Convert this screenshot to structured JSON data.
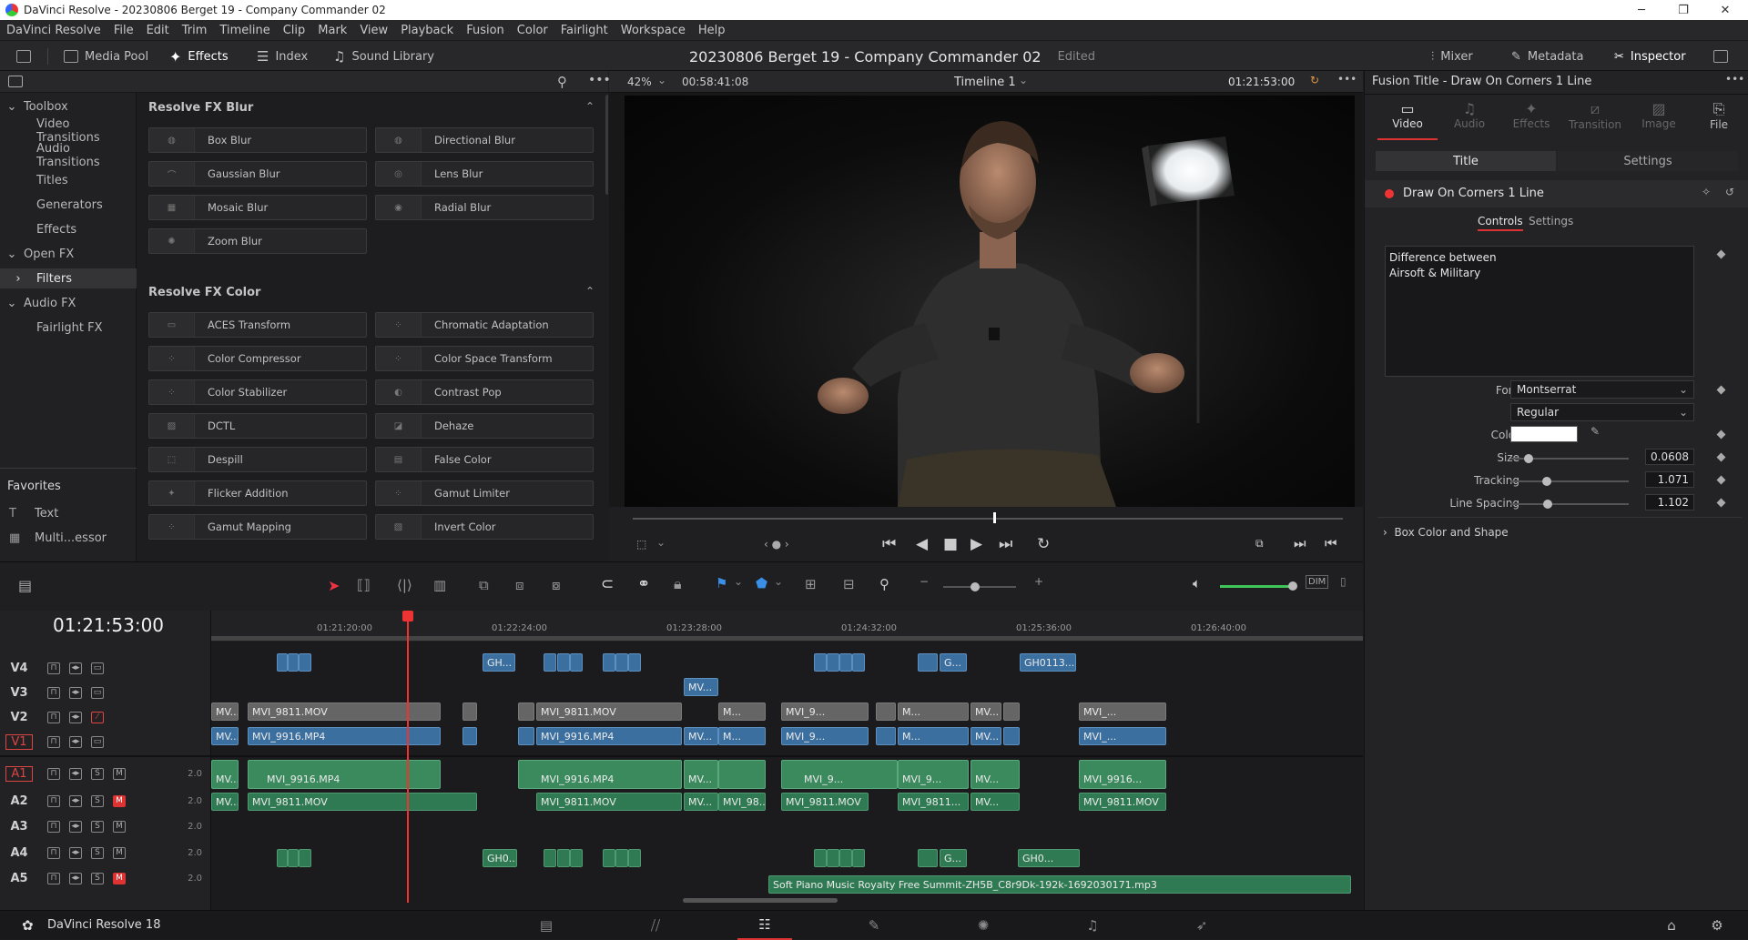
{
  "window": {
    "title": "DaVinci Resolve - 20230806 Berget 19 - Company Commander 02"
  },
  "menu": [
    "DaVinci Resolve",
    "File",
    "Edit",
    "Trim",
    "Timeline",
    "Clip",
    "Mark",
    "View",
    "Playback",
    "Fusion",
    "Color",
    "Fairlight",
    "Workspace",
    "Help"
  ],
  "toolbar": {
    "media_pool": "Media Pool",
    "effects": "Effects",
    "index": "Index",
    "sound_library": "Sound Library",
    "project_title": "20230806 Berget 19 - Company Commander 02",
    "edited": "Edited",
    "mixer": "Mixer",
    "metadata": "Metadata",
    "inspector": "Inspector"
  },
  "toolbox": {
    "items": [
      "Toolbox",
      "Video Transitions",
      "Audio Transitions",
      "Titles",
      "Generators",
      "Effects",
      "Open FX",
      "Filters",
      "Audio FX",
      "Fairlight FX"
    ],
    "favorites_label": "Favorites",
    "favorites": [
      "Text",
      "Multi...essor"
    ]
  },
  "fx": {
    "blur_header": "Resolve FX Blur",
    "blur": [
      "Box Blur",
      "Directional Blur",
      "Gaussian Blur",
      "Lens Blur",
      "Mosaic Blur",
      "Radial Blur",
      "Zoom Blur"
    ],
    "color_header": "Resolve FX Color",
    "color": [
      "ACES Transform",
      "Chromatic Adaptation",
      "Color Compressor",
      "Color Space Transform",
      "Color Stabilizer",
      "Contrast Pop",
      "DCTL",
      "Dehaze",
      "Despill",
      "False Color",
      "Flicker Addition",
      "Gamut Limiter",
      "Gamut Mapping",
      "Invert Color"
    ]
  },
  "viewer": {
    "zoom": "42%",
    "source_tc": "00:58:41:08",
    "timeline_name": "Timeline 1",
    "record_tc": "01:21:53:00"
  },
  "inspector": {
    "header": "Fusion Title - Draw On Corners 1 Line",
    "tabs": [
      "Video",
      "Audio",
      "Effects",
      "Transition",
      "Image",
      "File"
    ],
    "subtabs": [
      "Title",
      "Settings"
    ],
    "effect_name": "Draw On Corners 1 Line",
    "ctrl_tabs": [
      "Controls",
      "Settings"
    ],
    "text_line1": "Difference between",
    "text_line2": "Airsoft & Military",
    "font_label": "Font",
    "font": "Montserrat",
    "style": "Regular",
    "color_label": "Color",
    "color_value": "#ffffff",
    "size_label": "Size",
    "size": "0.0608",
    "tracking_label": "Tracking",
    "tracking": "1.071",
    "line_spacing_label": "Line Spacing",
    "line_spacing": "1.102",
    "box_section": "Box Color and Shape"
  },
  "timeline": {
    "timecode": "01:21:53:00",
    "ruler": [
      "01:21:20:00",
      "01:22:24:00",
      "01:23:28:00",
      "01:24:32:00",
      "01:25:36:00",
      "01:26:40:00"
    ],
    "tracks": [
      {
        "name": "V4"
      },
      {
        "name": "V3"
      },
      {
        "name": "V2"
      },
      {
        "name": "V1"
      },
      {
        "name": "A1",
        "level": "2.0"
      },
      {
        "name": "A2",
        "level": "2.0"
      },
      {
        "name": "A3",
        "level": "2.0"
      },
      {
        "name": "A4",
        "level": "2.0"
      },
      {
        "name": "A5",
        "level": "2.0"
      }
    ],
    "clips": {
      "v4": [
        "GH...",
        "G...",
        "GH0113..."
      ],
      "v3": [
        "MV..."
      ],
      "v2": [
        "MV...",
        "MVI_9811.MOV",
        "MVI_9811.MOV",
        "M...",
        "MVI_9...",
        "M...",
        "MV...",
        "MVI_..."
      ],
      "v1": [
        "MV...",
        "MVI_9916.MP4",
        "MVI_9916.MP4",
        "MV...",
        "M...",
        "MVI_9...",
        "M...",
        "MV...",
        "MVI_..."
      ],
      "a1": [
        "MV...",
        "MVI_9916.MP4",
        "MVI_9916.MP4",
        "MV...",
        "MVI_9...",
        "MVI_9...",
        "MV...",
        "MVI_9916..."
      ],
      "a2": [
        "MV...",
        "MVI_9811.MOV",
        "MVI_9811.MOV",
        "MV...",
        "MVI_98...",
        "MVI_9811.MOV",
        "MVI_9811...",
        "MV...",
        "MVI_9811.MOV"
      ],
      "a4": [
        "GH0...",
        "G...",
        "GH0..."
      ],
      "a5": "Soft Piano Music Royalty Free Summit-ZH5B_C8r9Dk-192k-1692030171.mp3"
    }
  },
  "status": {
    "app": "DaVinci Resolve 18"
  }
}
